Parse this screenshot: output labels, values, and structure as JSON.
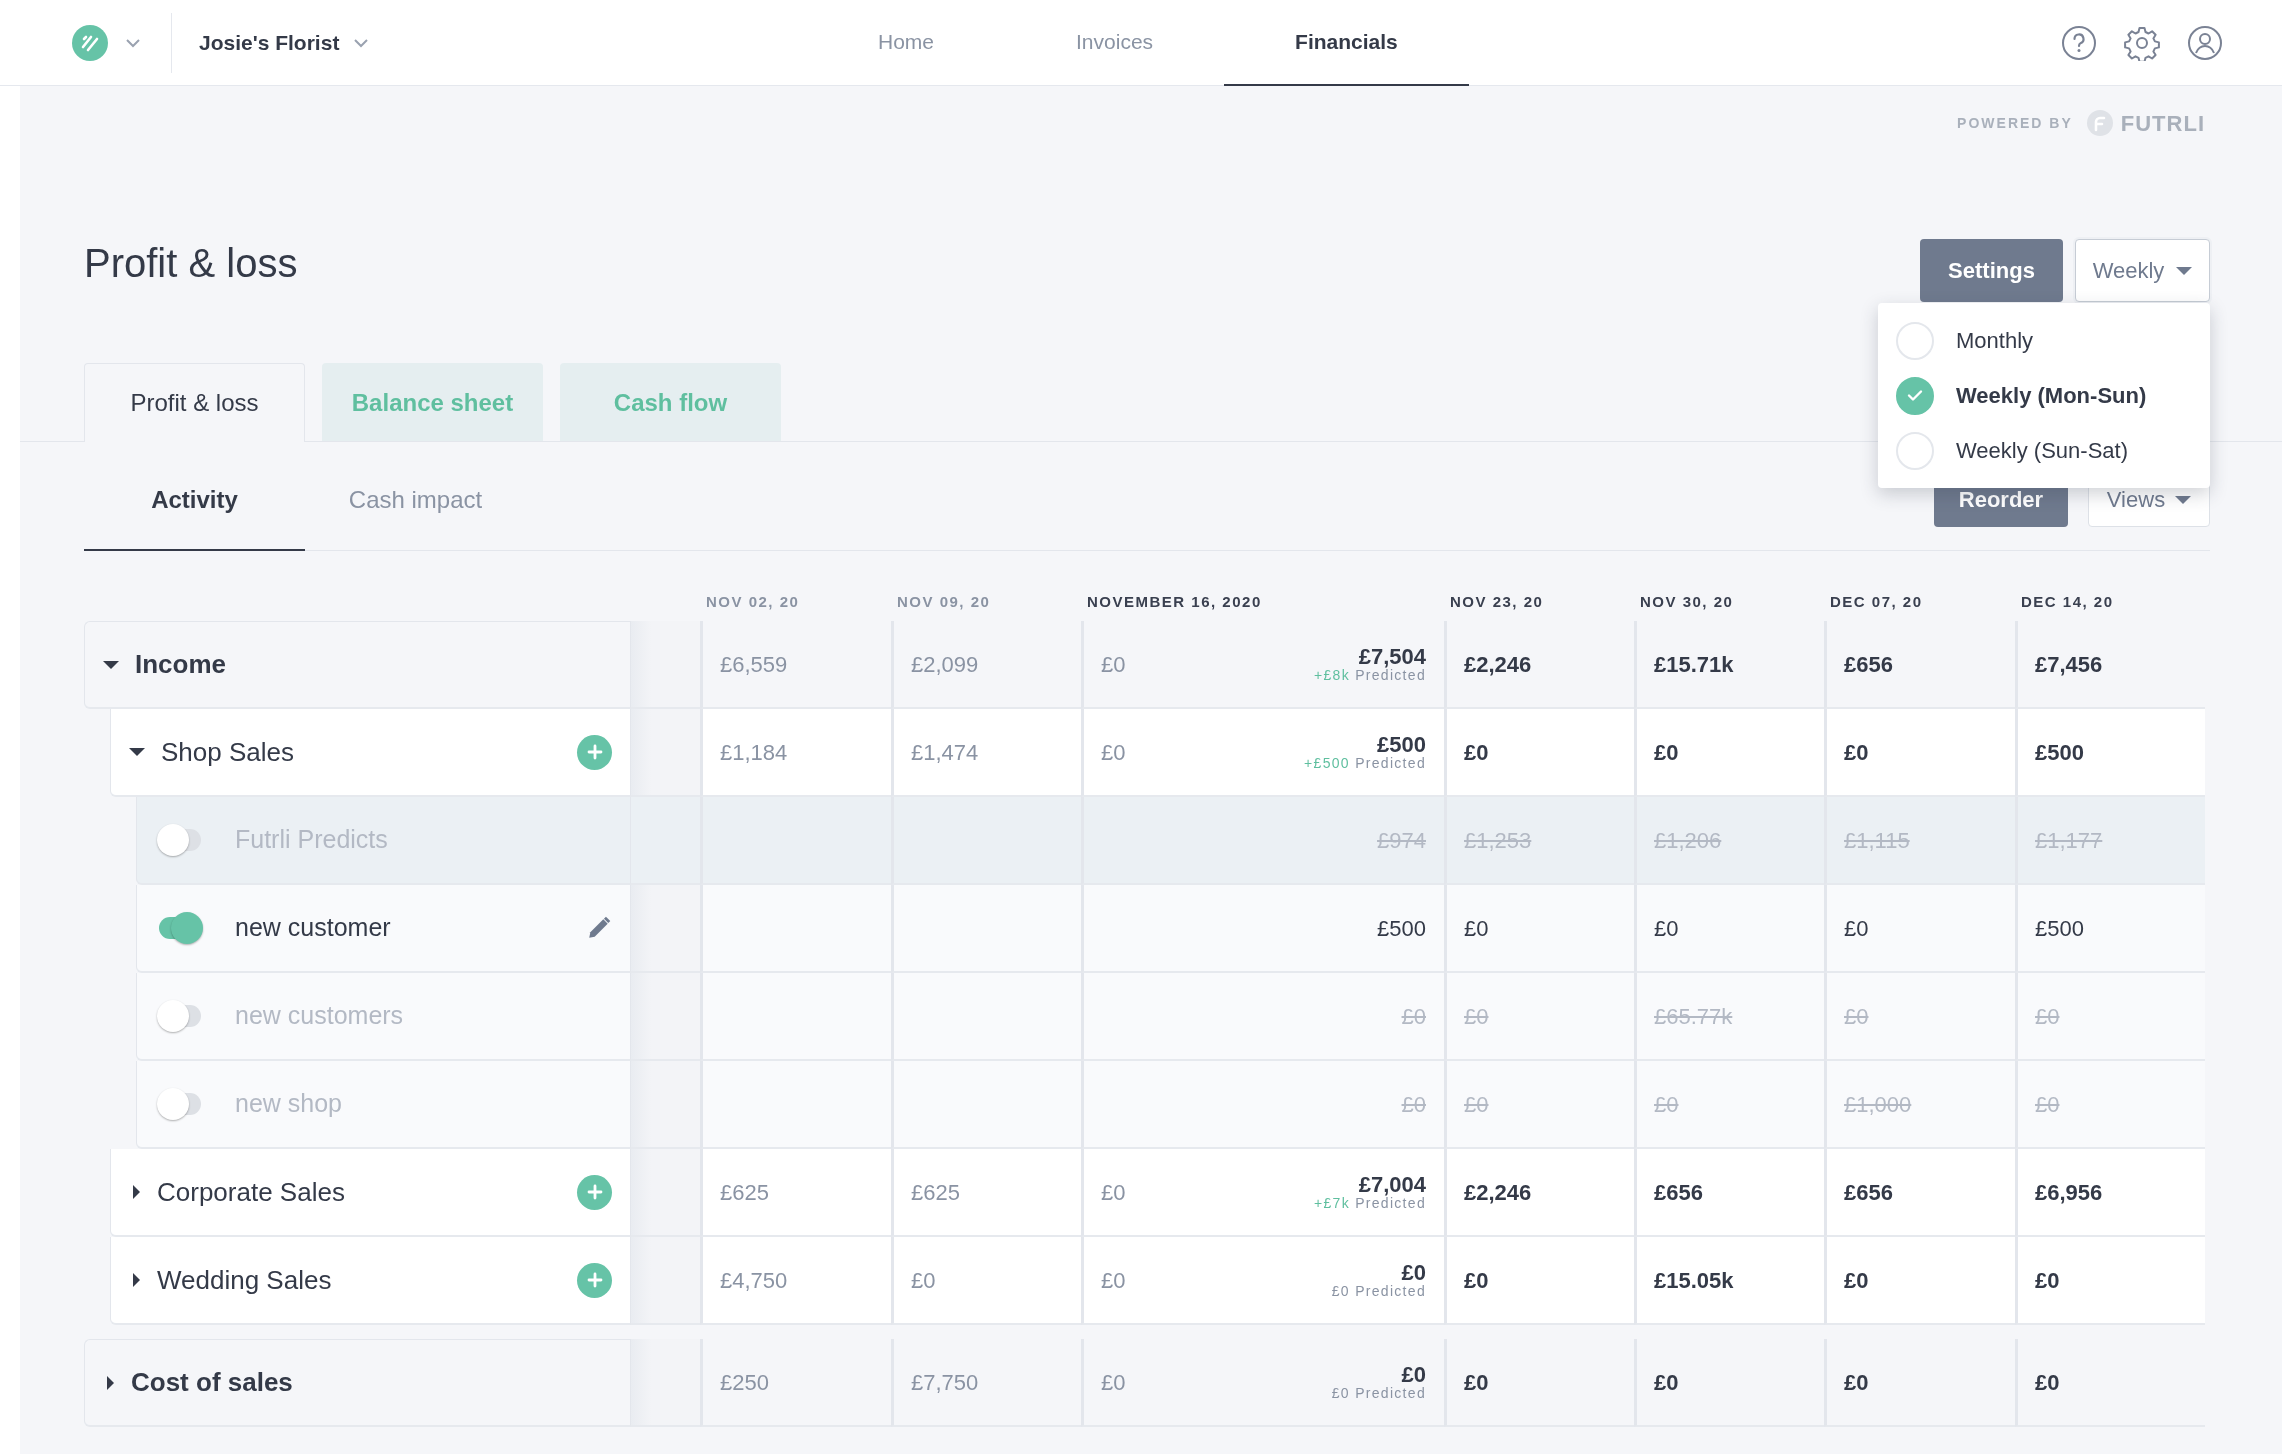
{
  "brand": {
    "company": "Josie's Florist"
  },
  "nav": [
    {
      "label": "Home",
      "selected": false
    },
    {
      "label": "Invoices",
      "selected": false
    },
    {
      "label": "Financials",
      "selected": true
    }
  ],
  "powered_by": {
    "label": "POWERED BY",
    "brand": "FUTRLI"
  },
  "page_title": "Profit & loss",
  "settings_button": "Settings",
  "period_dropdown": {
    "value": "Weekly",
    "expanded": true,
    "options": [
      {
        "label": "Monthly",
        "selected": false
      },
      {
        "label": "Weekly (Mon-Sun)",
        "selected": true
      },
      {
        "label": "Weekly (Sun-Sat)",
        "selected": false
      }
    ]
  },
  "tabs": [
    {
      "label": "Profit & loss",
      "selected": true
    },
    {
      "label": "Balance sheet",
      "selected": false
    },
    {
      "label": "Cash flow",
      "selected": false
    }
  ],
  "subtabs": [
    {
      "label": "Activity",
      "selected": true
    },
    {
      "label": "Cash impact",
      "selected": false
    }
  ],
  "reorder_button": "Reorder",
  "views_dropdown": "Views",
  "columns": [
    {
      "label": "NOV 02, 20",
      "kind": "past"
    },
    {
      "label": "NOV 09, 20",
      "kind": "past"
    },
    {
      "label": "NOVEMBER 16, 2020",
      "kind": "current"
    },
    {
      "label": "NOV 23, 20",
      "kind": "future"
    },
    {
      "label": "NOV 30, 20",
      "kind": "future"
    },
    {
      "label": "DEC 07, 20",
      "kind": "future"
    },
    {
      "label": "DEC 14, 20",
      "kind": "future"
    }
  ],
  "rows": [
    {
      "kind": "group",
      "label": "Income",
      "expanded": true,
      "cells": [
        "£6,559",
        "£2,099",
        {
          "actual": "£0",
          "total": "£7,504",
          "delta": "+£8k",
          "delta_positive": true,
          "note": "Predicted"
        },
        "£2,246",
        "£15.71k",
        "£656",
        "£7,456"
      ],
      "children": [
        {
          "kind": "category",
          "label": "Shop Sales",
          "expanded": true,
          "cells": [
            "£1,184",
            "£1,474",
            {
              "actual": "£0",
              "total": "£500",
              "delta": "+£500",
              "delta_positive": true,
              "note": "Predicted"
            },
            "£0",
            "£0",
            "£0",
            "£500"
          ],
          "children": [
            {
              "kind": "scenario",
              "label": "Futrli Predicts",
              "on": false,
              "highlighted": true,
              "editable": false,
              "cells": [
                null,
                null,
                "£974",
                "£1,253",
                "£1,206",
                "£1,115",
                "£1,177"
              ]
            },
            {
              "kind": "scenario",
              "label": "new customer",
              "on": true,
              "highlighted": false,
              "editable": true,
              "cells": [
                null,
                null,
                "£500",
                "£0",
                "£0",
                "£0",
                "£500"
              ]
            },
            {
              "kind": "scenario",
              "label": "new customers",
              "on": false,
              "highlighted": false,
              "editable": false,
              "cells": [
                null,
                null,
                "£0",
                "£0",
                "£65.77k",
                "£0",
                "£0"
              ]
            },
            {
              "kind": "scenario",
              "label": "new shop",
              "on": false,
              "highlighted": false,
              "editable": false,
              "cells": [
                null,
                null,
                "£0",
                "£0",
                "£0",
                "£1,000",
                "£0"
              ]
            }
          ]
        },
        {
          "kind": "category",
          "label": "Corporate Sales",
          "expanded": false,
          "cells": [
            "£625",
            "£625",
            {
              "actual": "£0",
              "total": "£7,004",
              "delta": "+£7k",
              "delta_positive": true,
              "note": "Predicted"
            },
            "£2,246",
            "£656",
            "£656",
            "£6,956"
          ]
        },
        {
          "kind": "category",
          "label": "Wedding Sales",
          "expanded": false,
          "cells": [
            "£4,750",
            "£0",
            {
              "actual": "£0",
              "total": "£0",
              "delta": "£0",
              "delta_positive": false,
              "note": "Predicted"
            },
            "£0",
            "£15.05k",
            "£0",
            "£0"
          ]
        }
      ]
    },
    {
      "kind": "group",
      "label": "Cost of sales",
      "expanded": false,
      "cells": [
        "£250",
        "£7,750",
        {
          "actual": "£0",
          "total": "£0",
          "delta": "£0",
          "delta_positive": false,
          "note": "Predicted"
        },
        "£0",
        "£0",
        "£0",
        "£0"
      ]
    }
  ]
}
